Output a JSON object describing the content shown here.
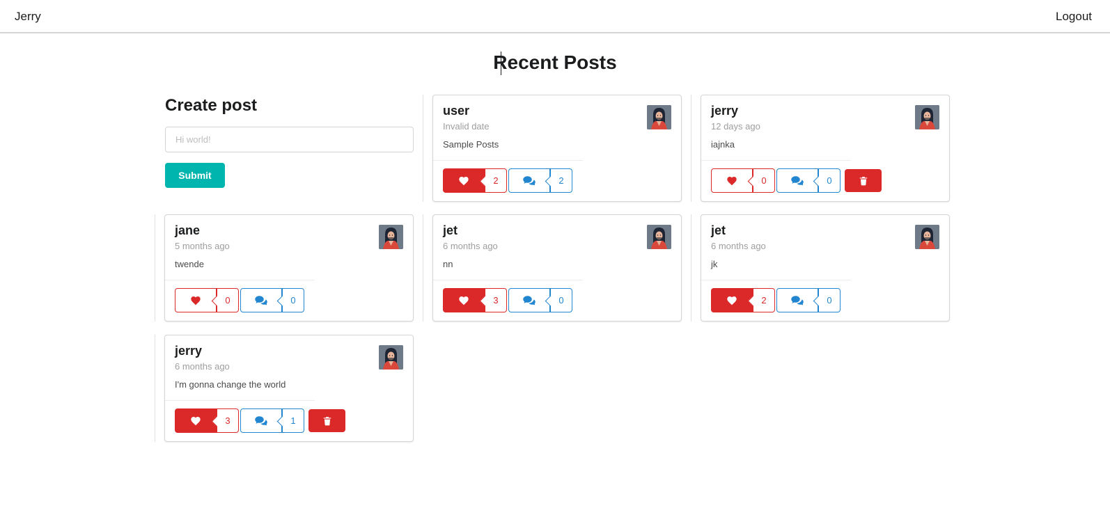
{
  "nav": {
    "brand": "Jerry",
    "logout": "Logout"
  },
  "page": {
    "title": "Recent Posts"
  },
  "create_post": {
    "heading": "Create post",
    "placeholder": "Hi world!",
    "value": "",
    "submit_label": "Submit"
  },
  "colors": {
    "like": "#db2828",
    "comment": "#2185d0",
    "submit": "#00b5ad"
  },
  "posts": [
    {
      "username": "user",
      "time": "Invalid date",
      "body": "Sample Posts",
      "likes": "2",
      "liked": true,
      "comments": "2",
      "can_delete": false
    },
    {
      "username": "jerry",
      "time": "12 days ago",
      "body": "iajnka",
      "likes": "0",
      "liked": false,
      "comments": "0",
      "can_delete": true
    },
    {
      "username": "jane",
      "time": "5 months ago",
      "body": "twende",
      "likes": "0",
      "liked": false,
      "comments": "0",
      "can_delete": false
    },
    {
      "username": "jet",
      "time": "6 months ago",
      "body": "nn",
      "likes": "3",
      "liked": true,
      "comments": "0",
      "can_delete": false
    },
    {
      "username": "jet",
      "time": "6 months ago",
      "body": "jk",
      "likes": "2",
      "liked": true,
      "comments": "0",
      "can_delete": false
    },
    {
      "username": "jerry",
      "time": "6 months ago",
      "body": "I'm gonna change the world",
      "likes": "3",
      "liked": true,
      "comments": "1",
      "can_delete": true
    }
  ],
  "icons": {
    "like": "heart-icon",
    "comment": "comment-icon",
    "delete": "trash-icon",
    "avatar": "user-avatar"
  }
}
